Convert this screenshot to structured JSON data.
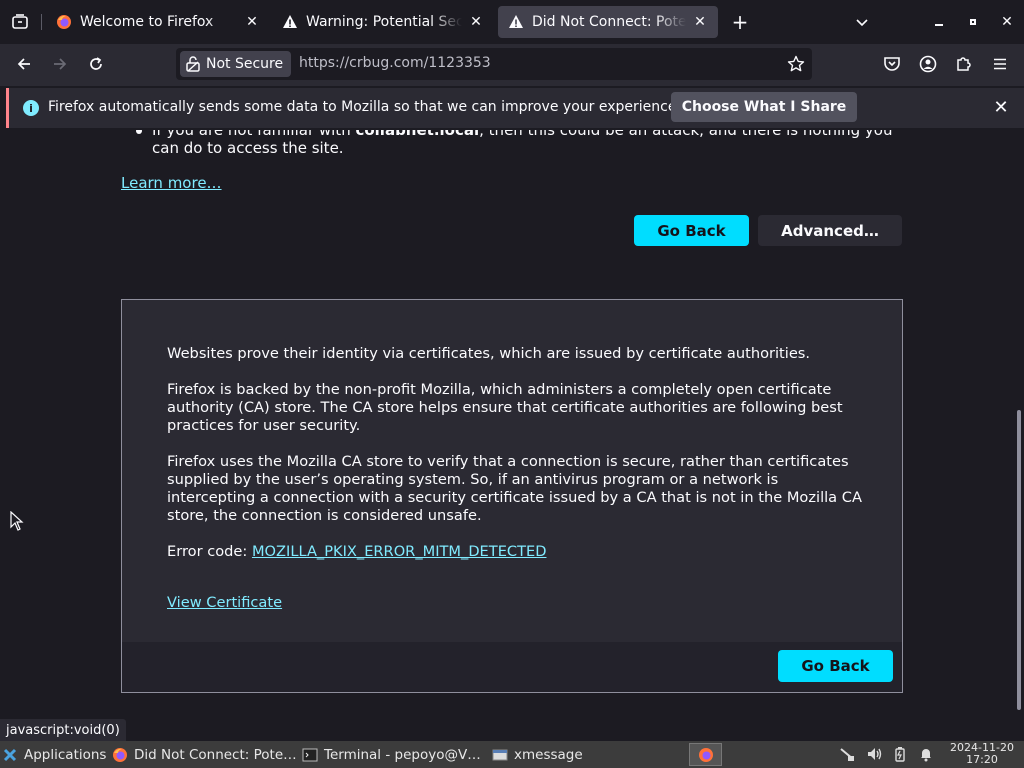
{
  "tabs": [
    {
      "title": "Welcome to Firefox",
      "favicon": "firefox-icon"
    },
    {
      "title": "Warning: Potential Security Risk Ahead",
      "favicon": "warning-icon"
    },
    {
      "title": "Did Not Connect: Potential Security Issue",
      "favicon": "warning-icon",
      "active": true
    }
  ],
  "navbar": {
    "not_secure_label": "Not Secure",
    "url": "https://crbug.com/1123353"
  },
  "notification": {
    "message": "Firefox automatically sends some data to Mozilla so that we can improve your experience.",
    "button_label": "Choose What I Share"
  },
  "content": {
    "partial_line_1_prefix": "If you are not familiar with ",
    "partial_line_1_bold": "collabnet.local",
    "partial_line_1_suffix": ", then this could be an attack, and there is nothing you",
    "partial_line_2": "can do to access the site.",
    "learn_more": "Learn more…",
    "go_back_label": "Go Back",
    "advanced_label": "Advanced…",
    "advanced_panel": {
      "para1": "Websites prove their identity via certificates, which are issued by certificate authorities.",
      "para2": "Firefox is backed by the non-profit Mozilla, which administers a completely open certificate authority (CA) store. The CA store helps ensure that certificate authorities are following best practices for user security.",
      "para3": "Firefox uses the Mozilla CA store to verify that a connection is secure, rather than certificates supplied by the user’s operating system. So, if an antivirus program or a network is intercepting a connection with a security certificate issued by a CA that is not in the Mozilla CA store, the connection is considered unsafe.",
      "error_code_label": "Error code: ",
      "error_code": "MOZILLA_PKIX_ERROR_MITM_DETECTED",
      "view_certificate": "View Certificate",
      "go_back_label": "Go Back"
    }
  },
  "status_text": "javascript:void(0)",
  "taskbar": {
    "applications_label": "Applications",
    "items": [
      {
        "label": "Did Not Connect: Pote…",
        "icon": "firefox-icon"
      },
      {
        "label": "Terminal - pepoyo@V…",
        "icon": "terminal-icon"
      },
      {
        "label": "xmessage",
        "icon": "window-icon"
      }
    ],
    "clock_date": "2024-11-20",
    "clock_time": "17:20"
  },
  "colors": {
    "accent": "#00ddff",
    "link": "#80ebff",
    "background": "#1c1b22",
    "panel": "#2b2a33"
  }
}
